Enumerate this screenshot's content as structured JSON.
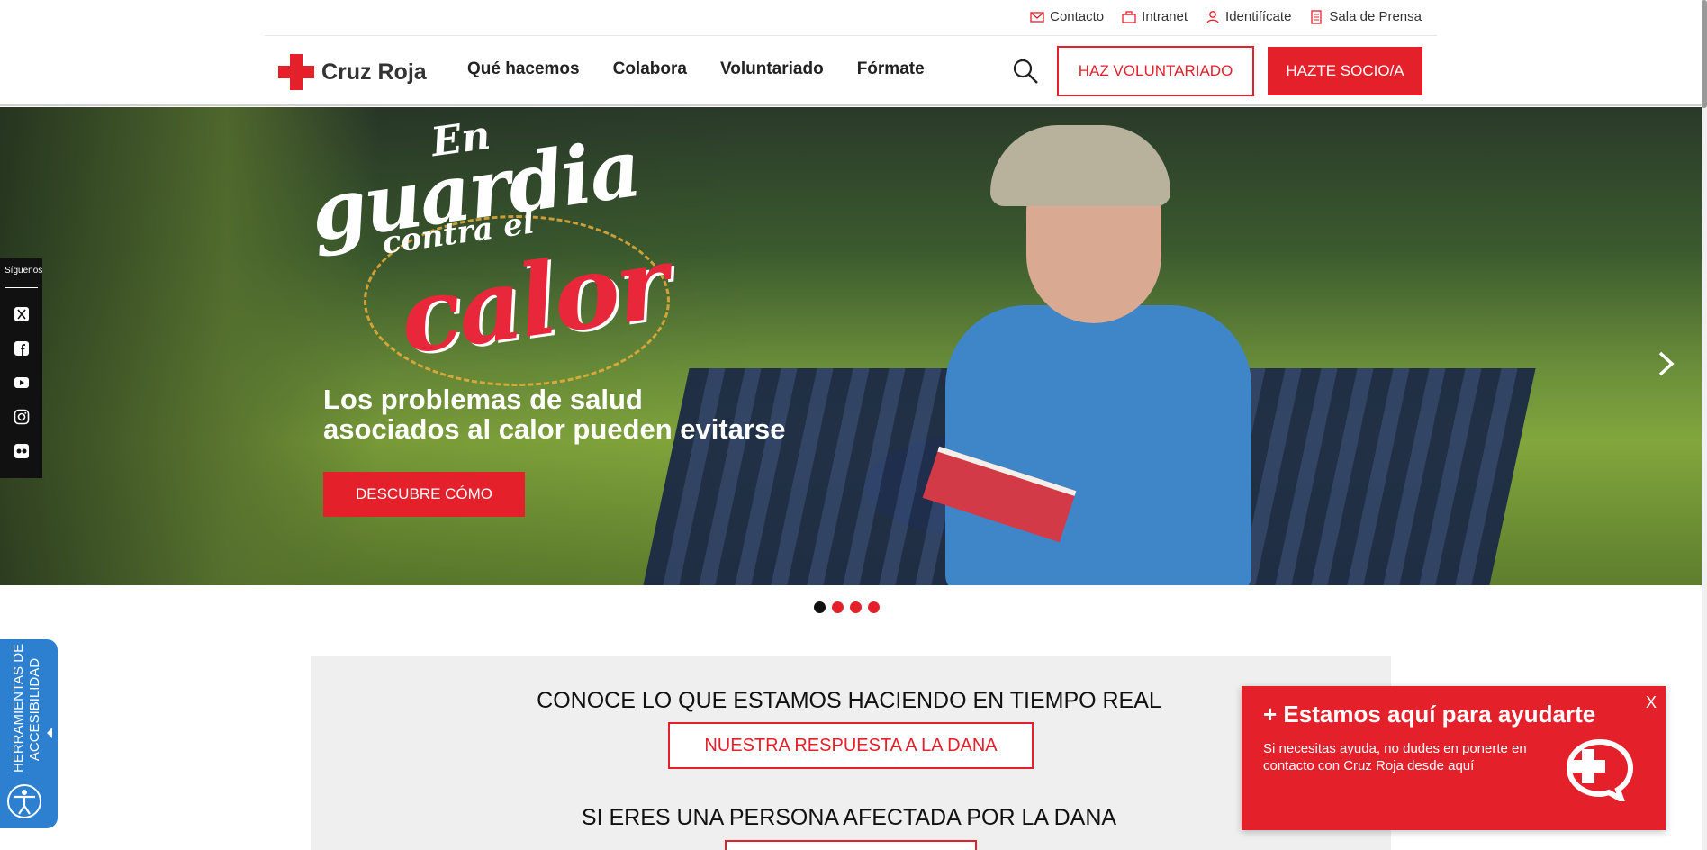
{
  "utility_links": [
    {
      "label": "Contacto",
      "icon": "mail-icon"
    },
    {
      "label": "Intranet",
      "icon": "briefcase-icon"
    },
    {
      "label": "Identifícate",
      "icon": "user-icon"
    },
    {
      "label": "Sala de Prensa",
      "icon": "document-icon"
    }
  ],
  "header": {
    "logo_text": "Cruz Roja",
    "nav": [
      "Qué hacemos",
      "Colabora",
      "Voluntariado",
      "Fórmate"
    ],
    "volunteer_button": "HAZ VOLUNTARIADO",
    "member_button": "HAZTE SOCIO/A"
  },
  "hero": {
    "logo_line1": "En",
    "logo_line2": "guardia",
    "logo_line3": "contra el",
    "logo_line4": "calor",
    "title_line1": "Los problemas de salud",
    "title_line2": "asociados al calor pueden evitarse",
    "cta": "DESCUBRE CÓMO",
    "slides": 4,
    "active_slide": 1
  },
  "social": {
    "label": "Síguenos",
    "icons": [
      "x-twitter-icon",
      "facebook-icon",
      "youtube-icon",
      "instagram-icon",
      "flickr-icon"
    ]
  },
  "accessibility": {
    "label_line1": "HERRAMIENTAS DE",
    "label_line2": "ACCESIBILIDAD"
  },
  "info": {
    "heading1": "CONOCE LO QUE ESTAMOS HACIENDO EN TIEMPO REAL",
    "button1": "NUESTRA RESPUESTA A LA DANA",
    "heading2": "SI ERES UNA PERSONA AFECTADA POR LA DANA"
  },
  "help": {
    "title": "+ Estamos aquí para ayudarte",
    "text": "Si necesitas ayuda, no dudes en ponerte en contacto con Cruz Roja desde aquí",
    "close": "X"
  },
  "colors": {
    "brand_red": "#e4202b",
    "a11y_blue": "#2d7fd0",
    "black": "#111111"
  }
}
